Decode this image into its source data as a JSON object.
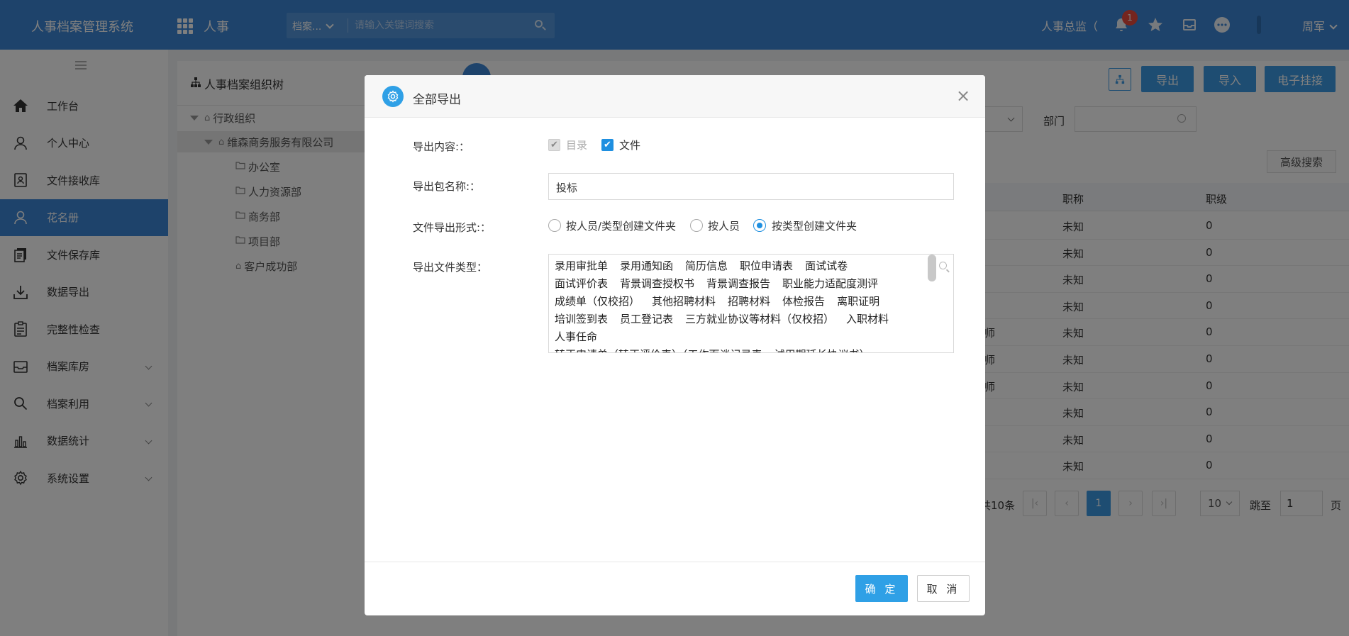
{
  "header": {
    "brand": "人事档案管理系统",
    "module": "人事",
    "search_scope": "档案...",
    "search_placeholder": "请输入关键词搜索",
    "role": "人事总监（",
    "notification_count": "1",
    "user": "周军",
    "icons": [
      "grid-icon",
      "search-icon",
      "bell-icon",
      "star-icon",
      "inbox-icon",
      "more-icon",
      "chevron-down-icon"
    ]
  },
  "sidebar": {
    "items": [
      {
        "label": "工作台",
        "icon": "home-icon",
        "active": false,
        "has_children": false
      },
      {
        "label": "个人中心",
        "icon": "user-icon",
        "active": false,
        "has_children": false
      },
      {
        "label": "文件接收库",
        "icon": "contact-card-icon",
        "active": false,
        "has_children": false
      },
      {
        "label": "花名册",
        "icon": "user-icon",
        "active": true,
        "has_children": false
      },
      {
        "label": "文件保存库",
        "icon": "files-icon",
        "active": false,
        "has_children": false
      },
      {
        "label": "数据导出",
        "icon": "download-icon",
        "active": false,
        "has_children": false
      },
      {
        "label": "完整性检查",
        "icon": "checklist-icon",
        "active": false,
        "has_children": false
      },
      {
        "label": "档案库房",
        "icon": "inbox-icon",
        "active": false,
        "has_children": true
      },
      {
        "label": "档案利用",
        "icon": "search-icon",
        "active": false,
        "has_children": true
      },
      {
        "label": "数据统计",
        "icon": "bar-chart-icon",
        "active": false,
        "has_children": true
      },
      {
        "label": "系统设置",
        "icon": "gear-icon",
        "active": false,
        "has_children": true
      }
    ]
  },
  "tree": {
    "title": "人事档案组织树",
    "nodes": [
      {
        "label": "行政组织",
        "level": 0,
        "expanded": true,
        "icon": "home-outline-icon"
      },
      {
        "label": "维森商务服务有限公司",
        "level": 1,
        "expanded": true,
        "icon": "home-outline-icon",
        "selected": true
      },
      {
        "label": "办公室",
        "level": 2,
        "icon": "folder-icon"
      },
      {
        "label": "人力资源部",
        "level": 2,
        "icon": "folder-icon"
      },
      {
        "label": "商务部",
        "level": 2,
        "icon": "folder-icon"
      },
      {
        "label": "项目部",
        "level": 2,
        "icon": "folder-icon"
      },
      {
        "label": "客户成功部",
        "level": 2,
        "icon": "home-outline-icon"
      }
    ]
  },
  "main": {
    "buttons": {
      "export": "导出",
      "import": "导入",
      "e_attach": "电子挂接",
      "advanced_search": "高级搜索"
    },
    "filter": {
      "dept_label": "部门",
      "dept_value": ""
    },
    "table": {
      "columns": [
        "职称",
        "职级"
      ],
      "rows": [
        {
          "partial": "",
          "title": "未知",
          "level": "0"
        },
        {
          "partial": "",
          "title": "未知",
          "level": "0"
        },
        {
          "partial": "",
          "title": "未知",
          "level": "0"
        },
        {
          "partial": "",
          "title": "未知",
          "level": "0"
        },
        {
          "partial": "师",
          "title": "未知",
          "level": "0"
        },
        {
          "partial": "师",
          "title": "未知",
          "level": "0"
        },
        {
          "partial": "师",
          "title": "未知",
          "level": "0"
        },
        {
          "partial": "",
          "title": "未知",
          "level": "0"
        },
        {
          "partial": "",
          "title": "未知",
          "level": "0"
        },
        {
          "partial": "",
          "title": "未知",
          "level": "0"
        }
      ]
    },
    "pager": {
      "total_text": "共10条",
      "current_page": "1",
      "page_size": "10",
      "goto_label": "跳至",
      "goto_value": "1",
      "page_unit": "页"
    }
  },
  "modal": {
    "title": "全部导出",
    "labels": {
      "content": "导出内容:：",
      "package_name": "导出包名称:：",
      "format": "文件导出形式:：",
      "file_types": "导出文件类型："
    },
    "content_options": [
      {
        "label": "目录",
        "checked": true,
        "disabled": true
      },
      {
        "label": "文件",
        "checked": true,
        "disabled": false
      }
    ],
    "package_name_value": "投标",
    "format_options": [
      {
        "label": "按人员/类型创建文件夹",
        "selected": false
      },
      {
        "label": "按人员",
        "selected": false
      },
      {
        "label": "按类型创建文件夹",
        "selected": true
      }
    ],
    "file_type_lines": [
      [
        "录用审批单",
        "录用通知函",
        "简历信息",
        "职位申请表",
        "面试试卷"
      ],
      [
        "面试评价表",
        "背景调查授权书",
        "背景调查报告",
        "职业能力适配度测评"
      ],
      [
        "成绩单（仅校招）",
        "其他招聘材料",
        "招聘材料",
        "体检报告",
        "离职证明"
      ],
      [
        "培训签到表",
        "员工登记表",
        "三方就业协议等材料（仅校招）",
        "入职材料"
      ],
      [
        "人事任命"
      ],
      [
        "转正申请单（转正评价表）（工作面谈记录表",
        "试用期延长协议书）"
      ]
    ],
    "ok_label": "确 定",
    "cancel_label": "取 消"
  }
}
